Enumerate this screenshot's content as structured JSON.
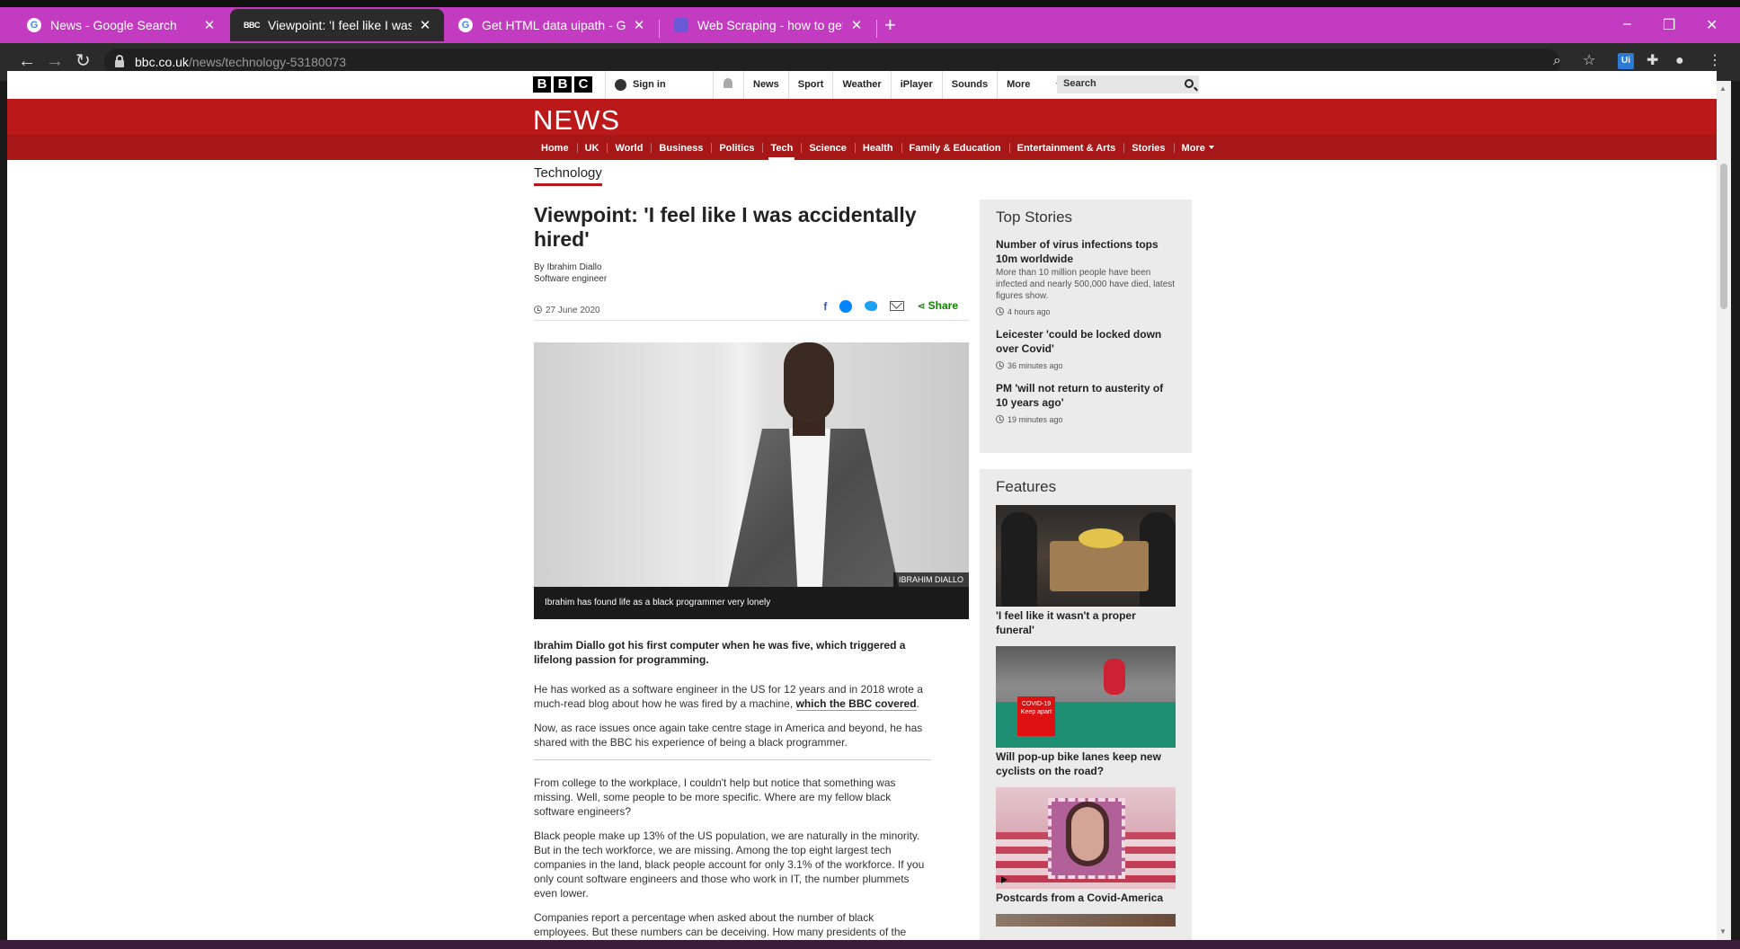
{
  "browser": {
    "tabs": [
      {
        "title": "News - Google Search",
        "icon": "google-icon",
        "active": false
      },
      {
        "title": "Viewpoint: 'I feel like I was accide",
        "icon": "bbc-icon",
        "active": true
      },
      {
        "title": "Get HTML data uipath - Google S",
        "icon": "google-icon",
        "active": false
      },
      {
        "title": "Web Scraping - how to get html",
        "icon": "uipath-forum-icon",
        "active": false
      }
    ],
    "url_host": "bbc.co.uk",
    "url_path": "/news/technology-53180073",
    "extension_label": "Ui",
    "window_controls": [
      "–",
      "❐",
      "✕"
    ]
  },
  "bbc": {
    "logo_letters": [
      "B",
      "B",
      "C"
    ],
    "signin": "Sign in",
    "top_nav": [
      "News",
      "Sport",
      "Weather",
      "iPlayer",
      "Sounds",
      "More"
    ],
    "search_placeholder": "Search",
    "news_wordmark": "NEWS",
    "news_nav": [
      "Home",
      "UK",
      "World",
      "Business",
      "Politics",
      "Tech",
      "Science",
      "Health",
      "Family & Education",
      "Entertainment & Arts",
      "Stories",
      "More"
    ],
    "news_nav_active": "Tech"
  },
  "article": {
    "section": "Technology",
    "headline": "Viewpoint: 'I feel like I was accidentally hired'",
    "byline_author": "By Ibrahim Diallo",
    "byline_role": "Software engineer",
    "date": "27 June 2020",
    "share_label": "Share",
    "image_credit": "IBRAHIM DIALLO",
    "image_caption": "Ibrahim has found life as a black programmer very lonely",
    "lead": "Ibrahim Diallo got his first computer when he was five, which triggered a lifelong passion for programming.",
    "p1_text": "He has worked as a software engineer in the US for 12 years and in 2018 wrote a much-read blog about how he was fired by a machine, ",
    "p1_link": "which the BBC covered",
    "p1_end": ".",
    "p2": "Now, as race issues once again take centre stage in America and beyond, he has shared with the BBC his experience of being a black programmer.",
    "p3": "From college to the workplace, I couldn't help but notice that something was missing. Well, some people to be more specific. Where are my fellow black software engineers?",
    "p4": "Black people make up 13% of the US population, we are naturally in the minority. But in the tech workforce, we are missing. Among the top eight largest tech companies in the land, black people account for only 3.1% of the workforce. If you only count software engineers and those who work in IT, the number plummets even lower.",
    "p5": "Companies report a percentage when asked about the number of black employees. But these numbers can be deceiving. How many presidents of the United States"
  },
  "sidebar": {
    "top_stories_title": "Top Stories",
    "top_stories": [
      {
        "title": "Number of virus infections tops 10m worldwide",
        "summary": "More than 10 million people have been infected and nearly 500,000 have died, latest figures show.",
        "time": "4 hours ago"
      },
      {
        "title": "Leicester 'could be locked down over Covid'",
        "summary": "",
        "time": "36 minutes ago"
      },
      {
        "title": "PM 'will not return to austerity of 10 years ago'",
        "summary": "",
        "time": "19 minutes ago"
      }
    ],
    "features_title": "Features",
    "features": [
      {
        "title": "'I feel like it wasn't a proper funeral'"
      },
      {
        "title": "Will pop-up bike lanes keep new cyclists on the road?",
        "sign_text": "COVID-19 Keep apart"
      },
      {
        "title": "Postcards from a Covid-America"
      }
    ]
  }
}
